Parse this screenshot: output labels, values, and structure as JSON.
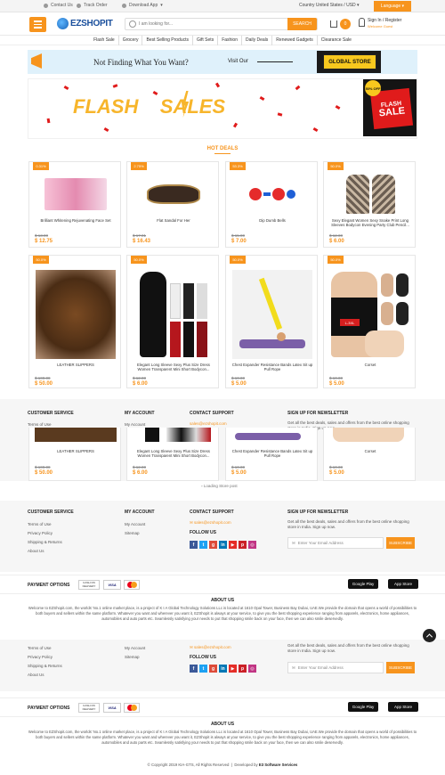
{
  "topbar": {
    "contact": "Contact Us",
    "track": "Track Order",
    "download": "Download App",
    "country": "Country United States / USD",
    "language": "Language"
  },
  "header": {
    "logo_text": "EZSHOPIT",
    "search_placeholder": "I am looking for...",
    "search_button": "SEARCH",
    "cart_count": "0",
    "account_title": "Sign In / Register",
    "account_sub": "Welcome Guest"
  },
  "categories": [
    "Flash Sale",
    "Grocery",
    "Best Selling Products",
    "Gift Sets",
    "Fashion",
    "Daily Deals",
    "Renewed Gadgets",
    "Clearance Sale"
  ],
  "banner1": {
    "text": "Not Finding What You Want?",
    "visit": "Visit Our",
    "store": "GLOBAL STORE"
  },
  "banner2": {
    "flash": "FLASH",
    "sales": "SALES",
    "card_top": "FLASH",
    "card_bottom": "SALE",
    "disc": "50% OFF"
  },
  "hot_deals_title": "HOT DEALS",
  "products_row1": [
    {
      "tag": "0.31%",
      "name": "Brilliant Whitening Rejuvenating Face Set",
      "old": "$ 13.00",
      "new": "$ 12.75",
      "img": "pink"
    },
    {
      "tag": "2.75%",
      "name": "Flat Sandal For Her",
      "old": "$ 17.01",
      "new": "$ 16.43",
      "img": "sandal"
    },
    {
      "tag": "53.3%",
      "name": "Dip Dumb Bells",
      "old": "$ 15.00",
      "new": "$ 7.00",
      "img": "dumbbell"
    },
    {
      "tag": "50.0%",
      "name": "Sexy Elegant Women Sexy Snake Print Long Sleeves Bodycon Evening Party Club Pencil...",
      "old": "$ 12.00",
      "new": "$ 6.00",
      "img": "snake"
    }
  ],
  "products_row2": [
    {
      "tag": "50.0%",
      "name": "LEATHER SLIPPERS",
      "old": "$ 100.00",
      "new": "$ 50.00",
      "img": "slippers"
    },
    {
      "tag": "50.0%",
      "name": "Elegant Long Sleeve Sexy Plus Size Dress Women Transparent Mini Short Bodycon...",
      "old": "$ 12.00",
      "new": "$ 6.00",
      "img": "dress"
    },
    {
      "tag": "50.0%",
      "name": "Chest Expander Resistance Bands Latex Sit up Pull Rope",
      "old": "$ 10.00",
      "new": "$ 5.00",
      "img": "band"
    },
    {
      "tag": "50.0%",
      "name": "Corset",
      "old": "$ 10.00",
      "new": "$ 5.00",
      "img": "corset"
    }
  ],
  "overlap_row": {
    "names": [
      "LEATHER SLIPPERS",
      "Elegant Long Sleeve Sexy Plus Size Dress Women Transparent Mini Short Bodycon...",
      "Chest Expander Resistance Bands Latex Sit up Pull Rope",
      "Corset"
    ],
    "old": [
      "$ 100.00",
      "$ 12.00",
      "$ 10.00",
      "$ 10.00"
    ],
    "new": [
      "$ 50.00",
      "$ 6.00",
      "$ 5.00",
      "$ 5.00"
    ]
  },
  "loading_text": "Loading Store post",
  "footer": {
    "customer_service": "CUSTOMER SERVICE",
    "cs_links": [
      "Terms of Use",
      "Privacy Policy",
      "Shipping & Returns",
      "About Us"
    ],
    "my_account": "MY ACCOUNT",
    "acc_links": [
      "My Account",
      "Sitemap"
    ],
    "contact_support": "CONTACT SUPPORT",
    "email": "sales@ezshopit.com",
    "follow_us": "FOLLOW US",
    "newsletter": "SIGN UP FOR NEWSLETTER",
    "newsletter_text": "Get all the best deals, sales and offers from the best online shopping store in India. Sign up now.",
    "email_placeholder": "Enter Your Email Address",
    "subscribe": "SUBSCRIBE"
  },
  "payment": {
    "label": "PAYMENT OPTIONS",
    "cod": "CASH ON DELIVERY",
    "visa": "VISA",
    "google": "Google Play",
    "apple": "App Store"
  },
  "about": {
    "title": "ABOUT US",
    "text": "Welcome to EZShopit.com, the worlds' No.1 online market place, is a project of K I A Global Technology Solutions LLc is located at 1610 Opal Tower, Business Bay Dubai, UAE.We provide the domain that opens a world of possibilities to both buyers and sellers within the same platform. Whatever you want and wherever you want it, EZShopit is always at your service, to give you the best shopping experience ranging from apparels, electronics, home appliances, automobiles and auto parts etc. Seamlessly satisfying your needs to put that shopping smile back on your face, then we can also smile deservedly."
  },
  "copyright": "© Copyright 2019 KIA-GTS, All Rights Reserved",
  "developed_by": "Developed by",
  "developer": "E3 Software Services",
  "colors": {
    "accent": "#f7941d",
    "brand": "#1a4f9c"
  }
}
